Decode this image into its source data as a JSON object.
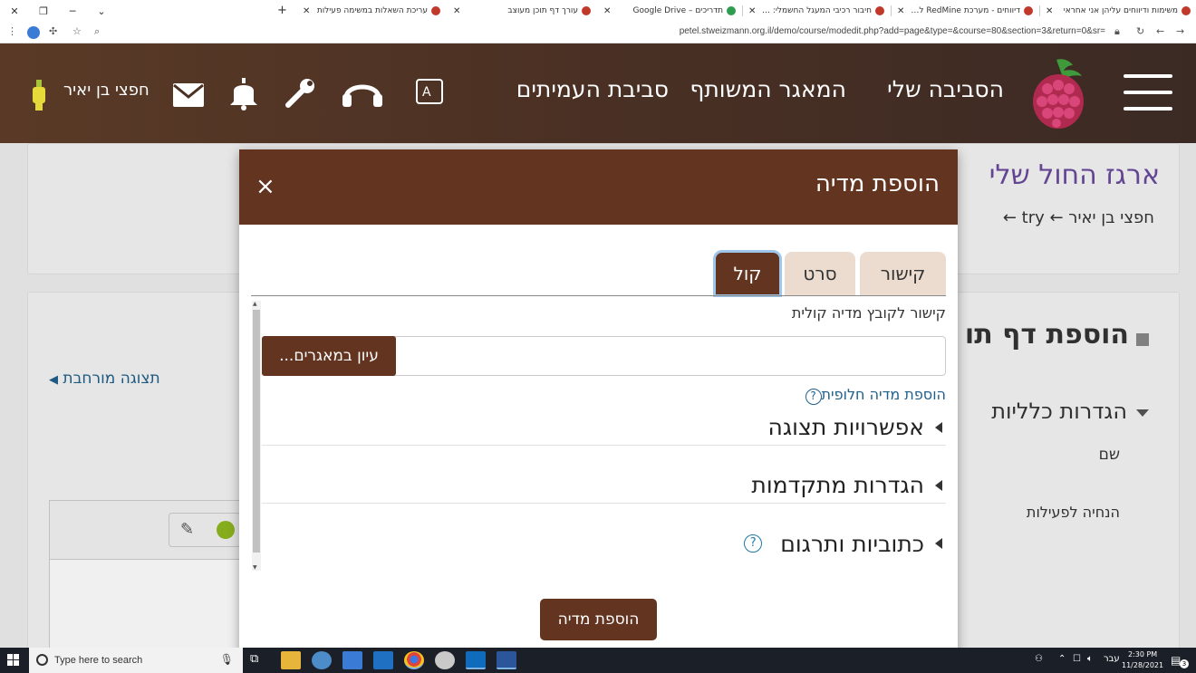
{
  "browser": {
    "tabs": [
      {
        "title": "משימות ודיווחים עליהן אני אחראי",
        "favicon_color": "#c0392b"
      },
      {
        "title": "דיווחים - מערכת RedMine לניהול",
        "favicon_color": "#c0392b"
      },
      {
        "title": "חיבור רכיבי המעגל החשמלי: סקי",
        "favicon_color": "#c0392b"
      },
      {
        "title": "תדריכים – Google Drive",
        "favicon_color": "#2e9d4f"
      },
      {
        "title": "עורך דף תוכן מעוצב",
        "favicon_color": "#c0392b"
      },
      {
        "title": "עריכת השאלות במשימה פעילות",
        "favicon_color": "#c0392b"
      }
    ],
    "active_tab_index": 4,
    "url": "petel.stweizmann.org.il/demo/course/modedit.php?add=page&type=&course=80&section=3&return=0&sr="
  },
  "header": {
    "nav": [
      "הסביבה שלי",
      "המאגר המשותף",
      "סביבת העמיתים"
    ],
    "username": "חפצי בן יאיר",
    "colors": {
      "bg_start": "#5a3a26",
      "bg_end": "#3b2a24"
    }
  },
  "page": {
    "title": "ארגז החול שלי",
    "breadcrumb": "חפצי בן יאיר ← try ←",
    "section_title": "הוספת דף תו",
    "general_settings": "הגדרות כלליות",
    "name_label": "שם",
    "guide_label": "הנחיה לפעילות",
    "expanded_view": "תצוגה מורחבת"
  },
  "modal": {
    "title": "הוספת מדיה",
    "close": "×",
    "tabs": [
      "קישור",
      "סרט",
      "קול"
    ],
    "active_tab": "קול",
    "voice_link_label": "קישור לקובץ מדיה קולית",
    "url_value": "",
    "browse_button": "עיון במאגרים...",
    "alt_media_link": "הוספת מדיה חלופית",
    "sections": [
      "אפשרויות תצוגה",
      "הגדרות מתקדמות",
      "כתוביות ותרגום"
    ],
    "submit_button": "הוספת מדיה",
    "accent_color": "#633521"
  },
  "taskbar": {
    "search_placeholder": "Type here to search",
    "language": "עבר",
    "time": "2:30 PM",
    "date": "11/28/2021",
    "notifications": "3"
  }
}
